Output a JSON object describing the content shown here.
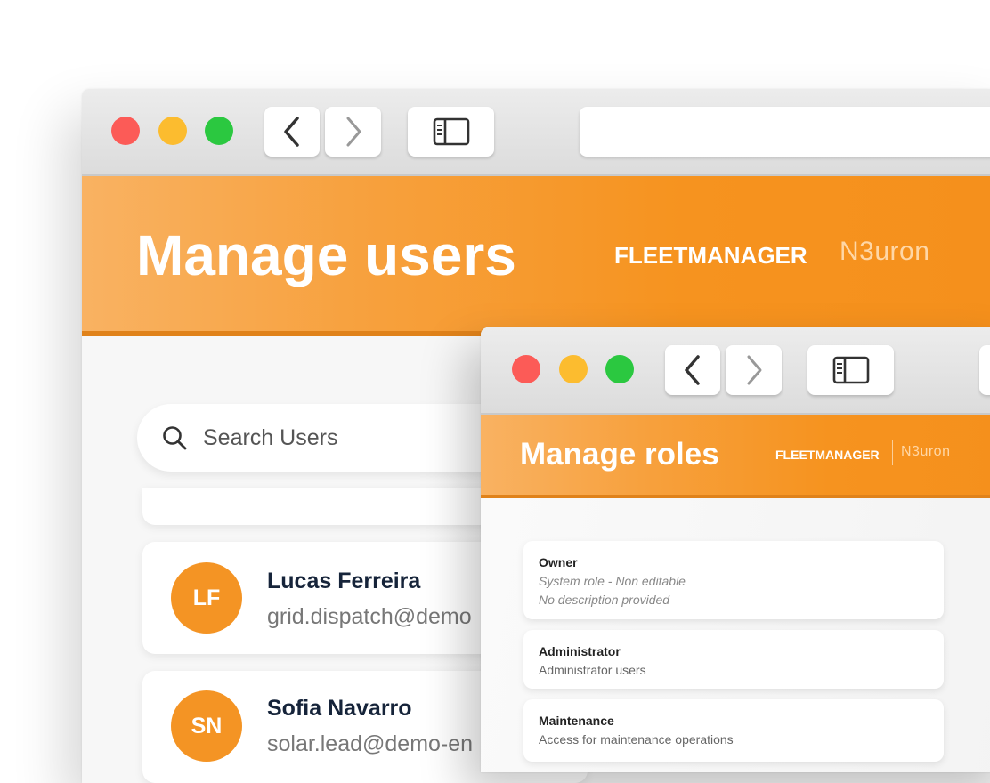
{
  "users_window": {
    "header": {
      "title": "Manage users",
      "brand": "FLEETMANAGER",
      "logo": "N3uron"
    },
    "search": {
      "placeholder": "Search Users",
      "icon": "search-icon"
    },
    "users": [
      {
        "initials": "LF",
        "name": "Lucas Ferreira",
        "email": "grid.dispatch@demo"
      },
      {
        "initials": "SN",
        "name": "Sofia Navarro",
        "email": "solar.lead@demo-en"
      }
    ]
  },
  "roles_window": {
    "header": {
      "title": "Manage roles",
      "brand": "FLEETMANAGER",
      "logo": "N3uron"
    },
    "roles": [
      {
        "name": "Owner",
        "lines": [
          "System role - Non editable",
          "No description provided"
        ]
      },
      {
        "name": "Administrator",
        "lines": [
          "Administrator users"
        ]
      },
      {
        "name": "Maintenance",
        "lines": [
          "Access for maintenance operations"
        ]
      }
    ]
  },
  "colors": {
    "accent": "#f6931f",
    "avatar": "#f49424",
    "close": "#fc5b57",
    "minimize": "#fcbc2f",
    "zoom": "#2bc840"
  }
}
